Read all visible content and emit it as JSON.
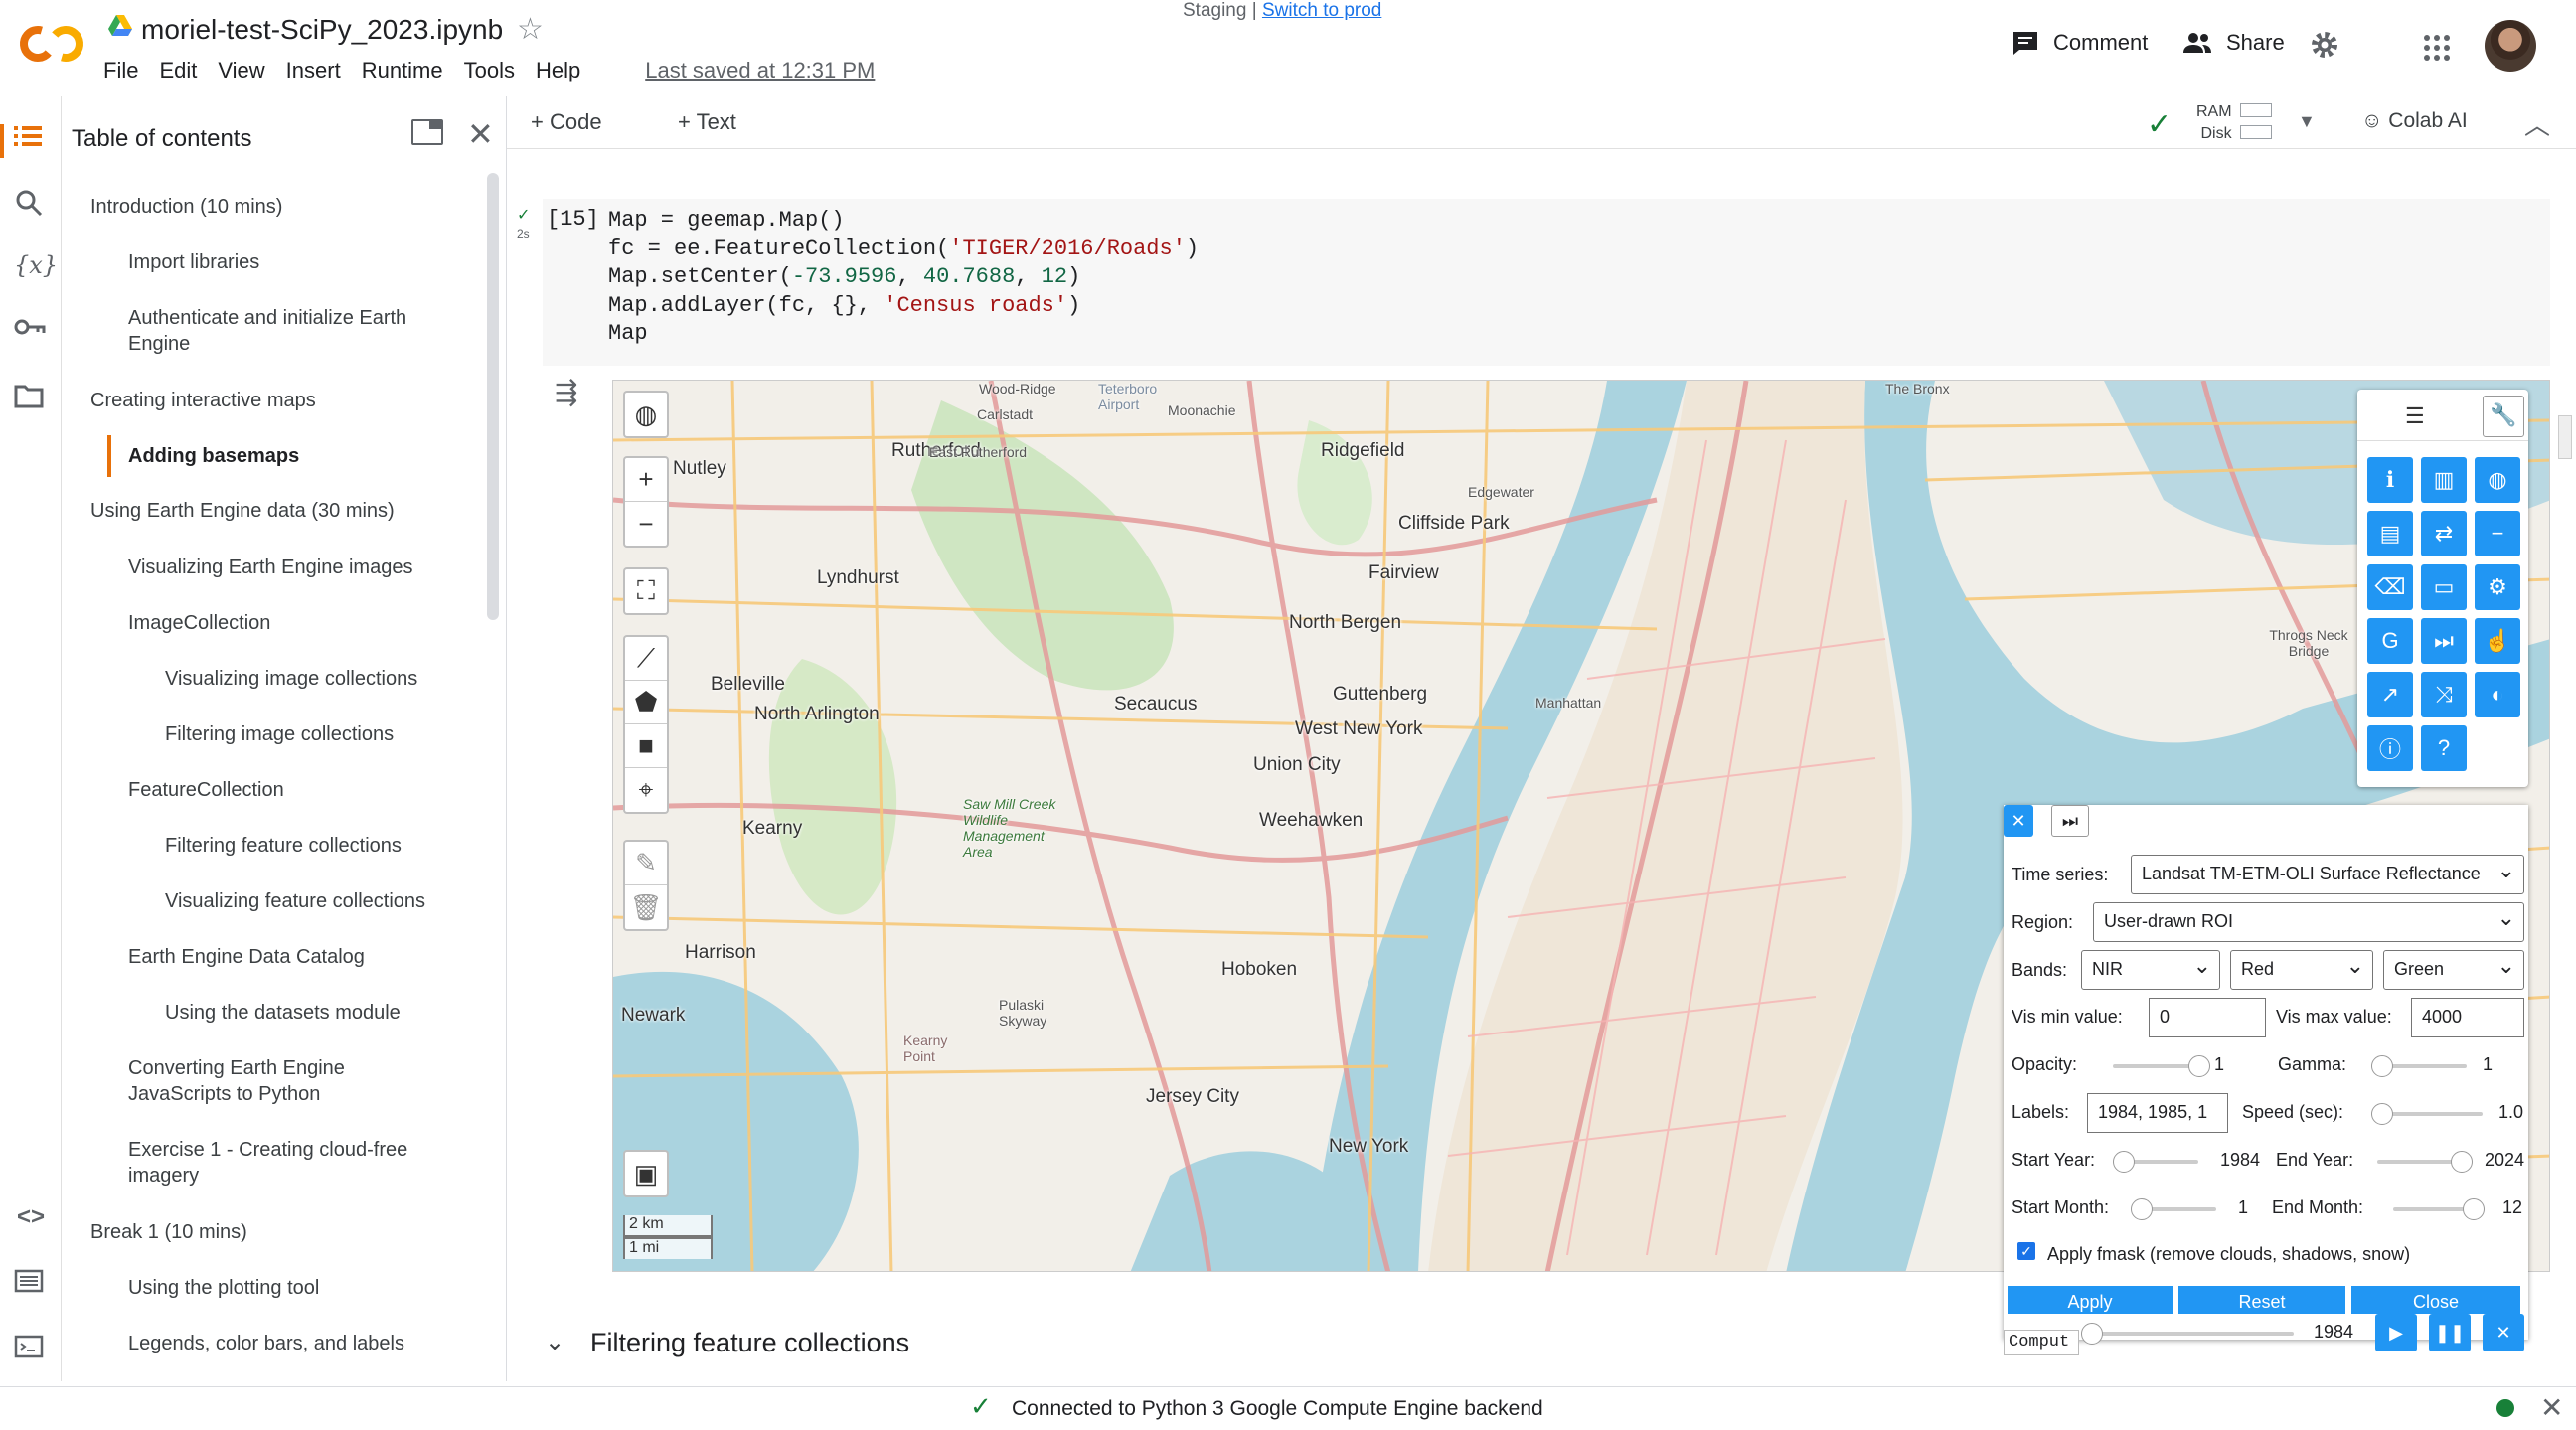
{
  "staging": {
    "label": "Staging",
    "sep": " | ",
    "link": "Switch to prod"
  },
  "notebook": {
    "title": "moriel-test-SciPy_2023.ipynb",
    "saved": "Last saved at 12:31 PM"
  },
  "menu": [
    "File",
    "Edit",
    "View",
    "Insert",
    "Runtime",
    "Tools",
    "Help"
  ],
  "header": {
    "comment": "Comment",
    "share": "Share"
  },
  "toc": {
    "title": "Table of contents",
    "items": [
      {
        "label": "Introduction (10 mins)"
      },
      {
        "label": "Import libraries"
      },
      {
        "label": "Authenticate and initialize Earth Engine"
      },
      {
        "label": "Creating interactive maps"
      },
      {
        "label": "Adding basemaps"
      },
      {
        "label": "Using Earth Engine data (30 mins)"
      },
      {
        "label": "Visualizing Earth Engine images"
      },
      {
        "label": "ImageCollection"
      },
      {
        "label": "Visualizing image collections"
      },
      {
        "label": "Filtering image collections"
      },
      {
        "label": "FeatureCollection"
      },
      {
        "label": "Filtering feature collections"
      },
      {
        "label": "Visualizing feature collections"
      },
      {
        "label": "Earth Engine Data Catalog"
      },
      {
        "label": "Using the datasets module"
      },
      {
        "label": "Converting Earth Engine JavaScripts to Python"
      },
      {
        "label": "Exercise 1 - Creating cloud-free imagery"
      },
      {
        "label": "Break 1 (10 mins)"
      },
      {
        "label": "Using the plotting tool"
      },
      {
        "label": "Legends, color bars, and labels"
      }
    ]
  },
  "toolbar": {
    "code": "+ Code",
    "text": "+ Text",
    "ram": "RAM",
    "disk": "Disk",
    "colab_ai": "Colab AI"
  },
  "cell": {
    "exec_count": "[15]",
    "run_time": "2s",
    "lines": [
      "Map = geemap.Map()",
      "fc = ee.FeatureCollection('TIGER/2016/Roads')",
      "Map.setCenter(-73.9596, 40.7688, 12)",
      "Map.addLayer(fc, {}, 'Census roads')",
      "Map"
    ]
  },
  "map": {
    "labels": [
      "Rutherford",
      "Nutley",
      "Lyndhurst",
      "Belleville",
      "North Arlington",
      "Kearny",
      "Harrison",
      "Newark",
      "Secaucus",
      "Ridgefield",
      "Cliffside Park",
      "Fairview",
      "North Bergen",
      "Guttenberg",
      "West New York",
      "Union City",
      "Weehawken",
      "Hoboken",
      "Jersey City",
      "New York",
      "Manhattan",
      "Edgewater",
      "Throgs Neck Bridge",
      "Wood-Ridge",
      "Carlstadt",
      "East Rutherford",
      "Moonachie",
      "Teterboro Airport",
      "Pulaski Skyway",
      "Kearny Point",
      "Saw Mill Creek Wildlife Management Area",
      "The Bronx"
    ],
    "scale_km": "2 km",
    "scale_mi": "1 mi"
  },
  "ts_form": {
    "time_series_label": "Time series:",
    "time_series_value": "Landsat TM-ETM-OLI Surface Reflectance",
    "region_label": "Region:",
    "region_value": "User-drawn ROI",
    "bands_label": "Bands:",
    "bands": [
      "NIR",
      "Red",
      "Green"
    ],
    "vis_min_label": "Vis min value:",
    "vis_min": "0",
    "vis_max_label": "Vis max value:",
    "vis_max": "4000",
    "opacity_label": "Opacity:",
    "opacity": "1",
    "gamma_label": "Gamma:",
    "gamma": "1",
    "labels_label": "Labels:",
    "labels_value": "1984, 1985, 1",
    "speed_label": "Speed (sec):",
    "speed": "1.0",
    "start_year_label": "Start Year:",
    "start_year": "1984",
    "end_year_label": "End Year:",
    "end_year": "2024",
    "start_month_label": "Start Month:",
    "start_month": "1",
    "end_month_label": "End Month:",
    "end_month": "12",
    "fmask_label": "Apply fmask (remove clouds, shadows, snow)",
    "apply": "Apply",
    "reset": "Reset",
    "close": "Close",
    "compute_label": "Comput",
    "player_year": "1984"
  },
  "section_heading": "Filtering feature collections",
  "status": {
    "text": "Connected to Python 3 Google Compute Engine backend"
  },
  "colors": {
    "accent": "#2196f3",
    "ok": "#188038",
    "logo_orange": "#f9ab00",
    "logo_red": "#e8710a"
  }
}
